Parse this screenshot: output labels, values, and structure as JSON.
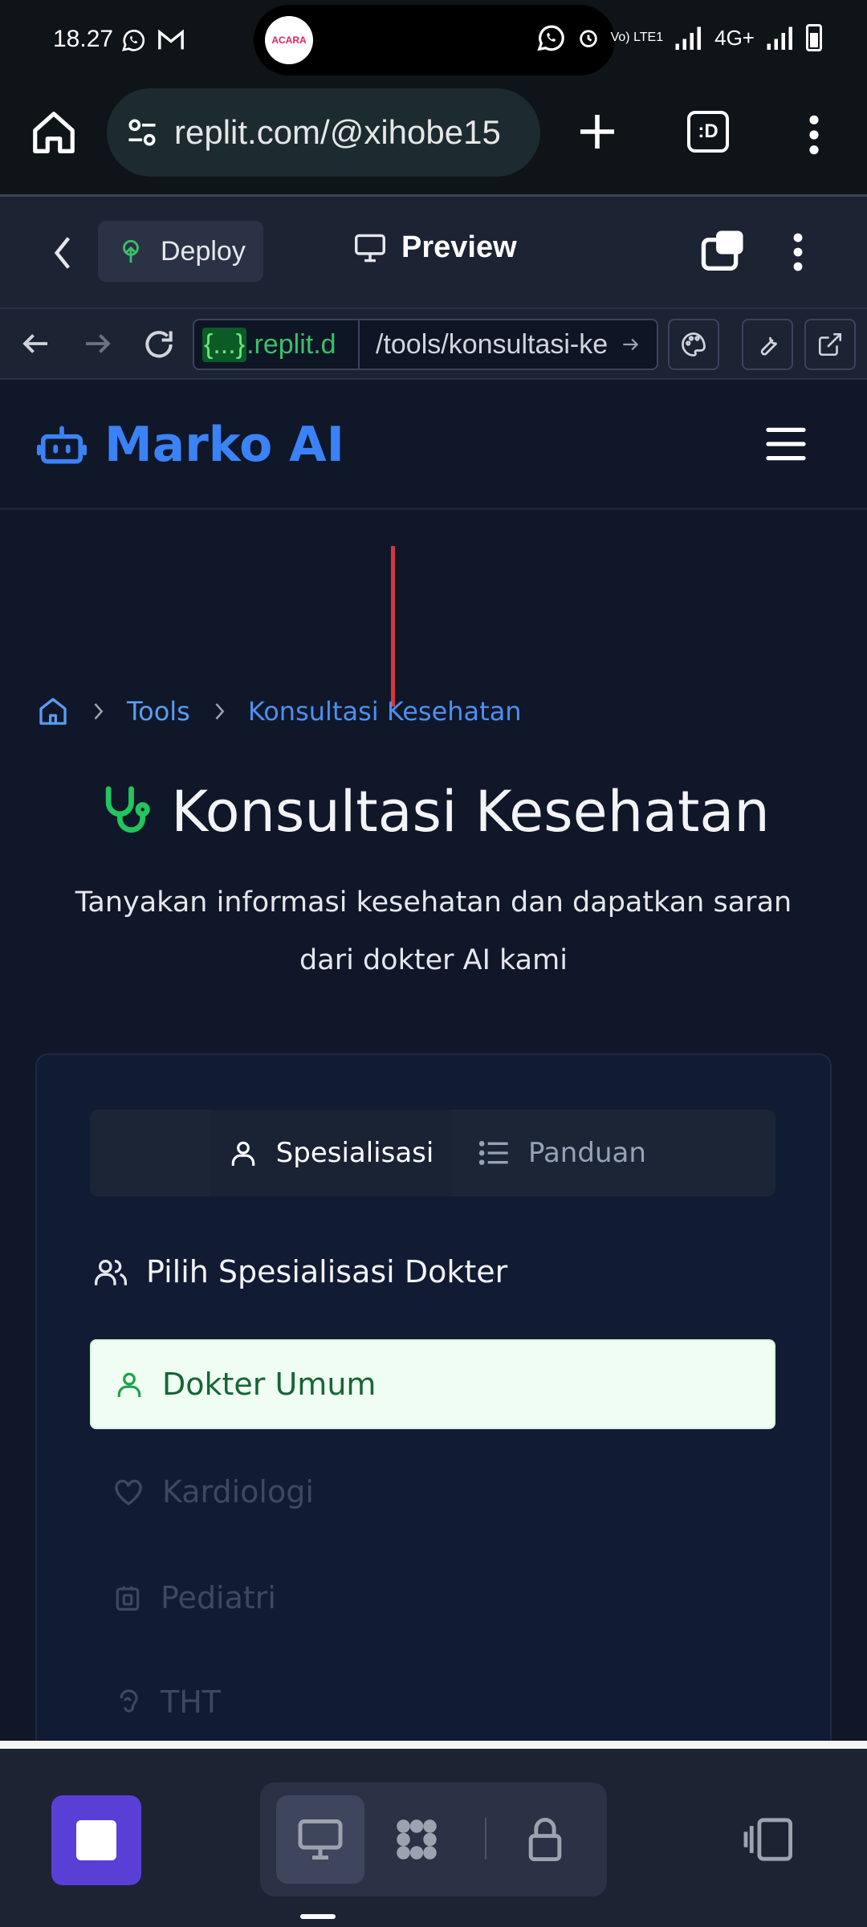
{
  "status_bar": {
    "time": "18.27",
    "app_badge": "ACARA",
    "volte": "Vo) LTE1",
    "network": "4G+"
  },
  "browser": {
    "url": "replit.com/@xihobe15",
    "tab_badge": ":D"
  },
  "replit_toolbar": {
    "deploy_label": "Deploy",
    "preview_label": "Preview"
  },
  "webview": {
    "domain_highlight": "{...}",
    "domain_rest": ".replit.d",
    "path": "/tools/konsultasi-ke"
  },
  "app": {
    "brand": "Marko AI",
    "accent": "#3b82f6"
  },
  "breadcrumb": {
    "items": [
      "Tools",
      "Konsultasi Kesehatan"
    ]
  },
  "page": {
    "title": "Konsultasi Kesehatan",
    "subtitle": "Tanyakan informasi kesehatan dan dapatkan saran dari dokter AI kami"
  },
  "tabs": [
    {
      "label": "Spesialisasi",
      "icon": "user-icon",
      "active": true
    },
    {
      "label": "Panduan",
      "icon": "list-icon",
      "active": false
    }
  ],
  "section": {
    "title": "Pilih Spesialisasi Dokter"
  },
  "specializations": [
    {
      "label": "Dokter Umum",
      "icon": "user-icon",
      "selected": true
    },
    {
      "label": "Kardiologi",
      "icon": "heart-icon",
      "selected": false
    },
    {
      "label": "Pediatri",
      "icon": "baby-icon",
      "selected": false
    },
    {
      "label": "THT",
      "icon": "ear-icon",
      "selected": false
    }
  ],
  "colors": {
    "background": "#0f1729",
    "selected_bg": "#effdf3",
    "selected_text": "#166534",
    "stethoscope": "#22c55e",
    "stop_button": "#5a3fd7"
  }
}
